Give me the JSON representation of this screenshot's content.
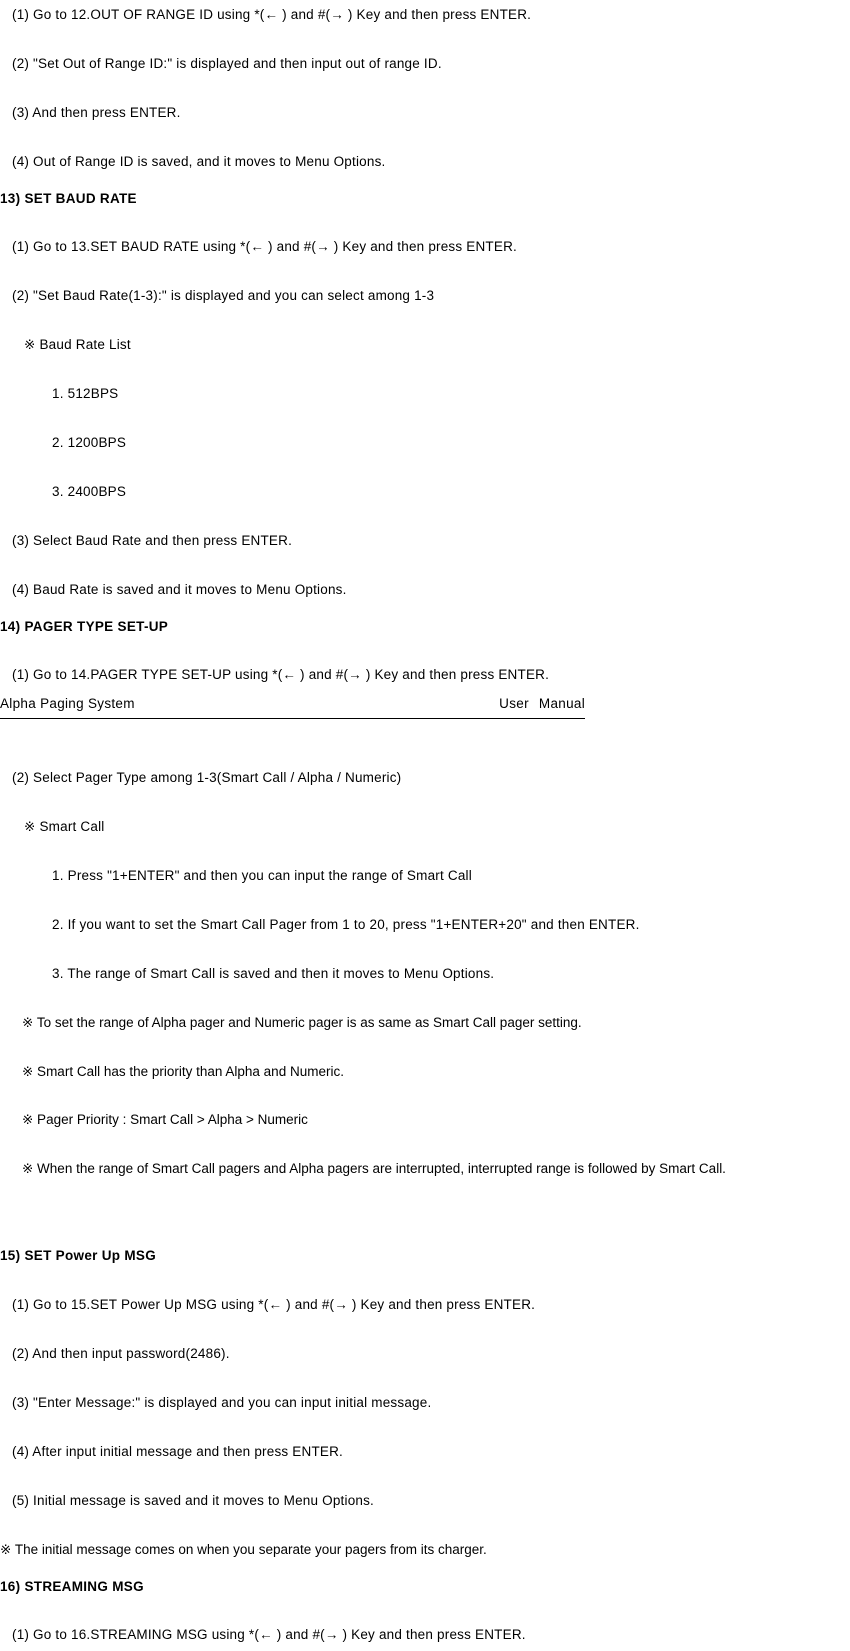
{
  "section12": {
    "s1": "(1) Go to 12.OUT OF RANGE ID using *(← ) and #(→ ) Key and then press ENTER.",
    "s2": "(2) \"Set Out of Range ID:\" is displayed and then input out of range ID.",
    "s3": "(3) And then press ENTER.",
    "s4": "(4) Out of Range ID is saved, and it moves to Menu Options."
  },
  "section13": {
    "heading": "13) SET BAUD RATE",
    "s1": "(1) Go to 13.SET BAUD RATE using *(← ) and #(→ ) Key and then press ENTER.",
    "s2": "(2) \"Set Baud Rate(1-3):\" is displayed and you can select among 1-3",
    "noteLabel": "※  Baud Rate List",
    "items": [
      "1. 512BPS",
      "2. 1200BPS",
      "3. 2400BPS"
    ],
    "s3": "(3) Select Baud Rate and then press ENTER.",
    "s4": "(4) Baud Rate is saved and it moves to Menu Options."
  },
  "section14": {
    "heading": "14) PAGER TYPE SET-UP",
    "s1": "(1) Go to 14.PAGER TYPE SET-UP using *(← ) and #(→ ) Key and then press ENTER.",
    "s2": "(2) Select Pager Type among 1-3(Smart Call / Alpha / Numeric)",
    "smartCallLabel": "※  Smart Call",
    "smartCallSteps": [
      "1. Press \"1+ENTER\" and then you can input the range of Smart Call",
      "2. If you want to set the Smart Call Pager from 1 to 20, press \"1+ENTER+20\" and then ENTER.",
      "3. The range of Smart Call is saved and then it moves to Menu Options."
    ],
    "notes": [
      "※  To set the range of Alpha pager and Numeric pager is as same as Smart Call pager setting.",
      "※  Smart Call has the priority than Alpha and Numeric.",
      "※  Pager Priority : Smart Call > Alpha > Numeric",
      "※  When the range of Smart Call pagers and Alpha pagers are interrupted, interrupted range is followed by Smart Call."
    ]
  },
  "section15": {
    "heading": "15) SET Power Up MSG",
    "s1": "(1) Go to 15.SET Power Up MSG using *(← ) and #(→ ) Key and then press ENTER.",
    "s2": "(2) And then input password(2486).",
    "s3": "(3) \"Enter Message:\" is displayed and you can input initial message.",
    "s4": "(4) After input initial message and then press ENTER.",
    "s5": "(5) Initial message is saved and it moves to Menu Options.",
    "note": "※  The initial message comes on when you separate your pagers from its charger."
  },
  "section16": {
    "heading": "16) STREAMING MSG",
    "s1": "(1) Go to 16.STREAMING MSG using *(← ) and #(→ ) Key and then press ENTER."
  },
  "footer": {
    "left": "Alpha Paging System",
    "right": "User  Manual"
  }
}
